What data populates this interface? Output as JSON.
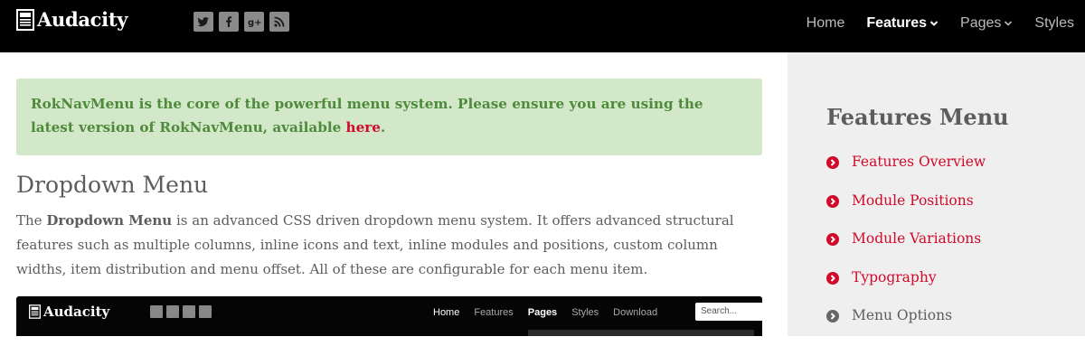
{
  "header": {
    "logo_text": "Audacity",
    "social": [
      "twitter-icon",
      "facebook-icon",
      "google-plus-icon",
      "rss-icon"
    ],
    "nav": [
      {
        "label": "Home",
        "active": false,
        "dropdown": false
      },
      {
        "label": "Features",
        "active": true,
        "dropdown": true
      },
      {
        "label": "Pages",
        "active": false,
        "dropdown": true
      },
      {
        "label": "Styles",
        "active": false,
        "dropdown": false
      }
    ]
  },
  "alert": {
    "text_before": "RokNavMenu is the core of the powerful menu system. Please ensure you are using the latest version of RokNavMenu, available ",
    "link_text": "here",
    "text_after": "."
  },
  "section": {
    "title": "Dropdown Menu",
    "body_prefix": "The ",
    "body_bold": "Dropdown Menu",
    "body_rest": " is an advanced CSS driven dropdown menu system. It offers advanced structural features such as multiple columns, inline icons and text, inline modules and positions, custom column widths, item distribution and menu offset. All of these are configurable for each menu item."
  },
  "preview": {
    "logo_text": "Audacity",
    "nav": [
      "Home",
      "Features",
      "Pages",
      "Styles",
      "Download"
    ],
    "search_placeholder": "Search..."
  },
  "sidebar": {
    "title": "Features Menu",
    "items": [
      {
        "label": "Features Overview",
        "active": true
      },
      {
        "label": "Module Positions",
        "active": true
      },
      {
        "label": "Module Variations",
        "active": true
      },
      {
        "label": "Typography",
        "active": true
      },
      {
        "label": "Menu Options",
        "active": false
      }
    ]
  },
  "colors": {
    "accent": "#d10a2a",
    "alert_bg": "#d2e8c9",
    "alert_text": "#4f8a3c",
    "text": "#5d5d5d",
    "sidebar_bg": "#efefef",
    "inactive_dot": "#666666"
  }
}
